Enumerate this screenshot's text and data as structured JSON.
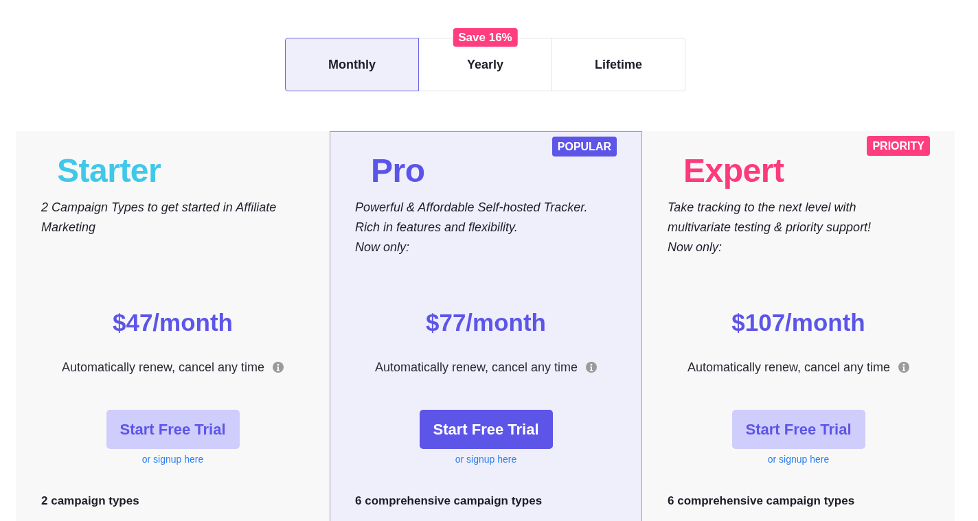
{
  "billing_tabs": [
    {
      "label": "Monthly",
      "selected": true
    },
    {
      "label": "Yearly",
      "selected": false,
      "badge": "Save 16%"
    },
    {
      "label": "Lifetime",
      "selected": false
    }
  ],
  "plans": [
    {
      "name": "Starter",
      "color": "#40c8e8",
      "featured": false,
      "description": "2 Campaign Types to get started in Affiliate Marketing",
      "price": "$47/month",
      "renewal_note": "Automatically renew, cancel any time",
      "button": "Start Free Trial",
      "signup_link": "or signup here",
      "features": [
        "2 campaign types"
      ]
    },
    {
      "name": "Pro",
      "color": "#5b54e8",
      "featured": true,
      "badge": {
        "text": "POPULAR",
        "color": "#5d55e8"
      },
      "description": "Powerful & Affordable Self-hosted Tracker.\nRich in features and flexibility.\nNow only:",
      "price": "$77/month",
      "renewal_note": "Automatically renew, cancel any time",
      "button": "Start Free Trial",
      "signup_link": "or signup here",
      "features": [
        "6 comprehensive campaign types"
      ]
    },
    {
      "name": "Expert",
      "color": "#fd3a7c",
      "featured": false,
      "badge": {
        "text": "PRIORITY",
        "color": "#ff3d7f"
      },
      "description": "Take tracking to the next level with\nmultivariate testing & priority support!\nNow only:",
      "price": "$107/month",
      "renewal_note": "Automatically renew, cancel any time",
      "button": "Start Free Trial",
      "signup_link": "or signup here",
      "features": [
        "6 comprehensive campaign types"
      ]
    }
  ]
}
